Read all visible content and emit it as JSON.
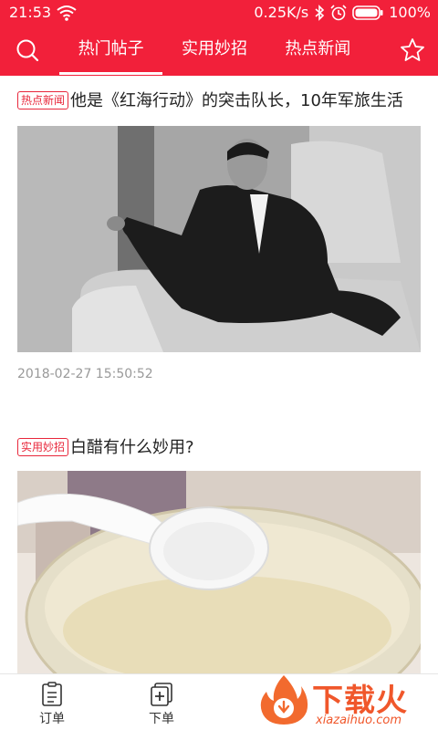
{
  "status_bar": {
    "time": "21:53",
    "net_speed": "0.25K/s",
    "battery": "100%"
  },
  "nav": {
    "tabs": [
      {
        "label": "热门帖子",
        "active": true
      },
      {
        "label": "实用妙招",
        "active": false
      },
      {
        "label": "热点新闻",
        "active": false
      }
    ]
  },
  "feed": {
    "posts": [
      {
        "tag": "热点新闻",
        "title": "他是《红海行动》的突击队长，10年军旅生活",
        "date": "2018-02-27 15:50:52"
      },
      {
        "tag": "实用妙招",
        "title": "白醋有什么妙用?"
      }
    ]
  },
  "tabbar": {
    "items": [
      {
        "label": "订单"
      },
      {
        "label": "下单"
      }
    ]
  },
  "watermark": {
    "title": "下载火",
    "domain": "xiazaihuo.com"
  },
  "colors": {
    "brand_red": "#f2203a",
    "tag_red": "#e8273b",
    "watermark_orange": "#f0572b"
  }
}
